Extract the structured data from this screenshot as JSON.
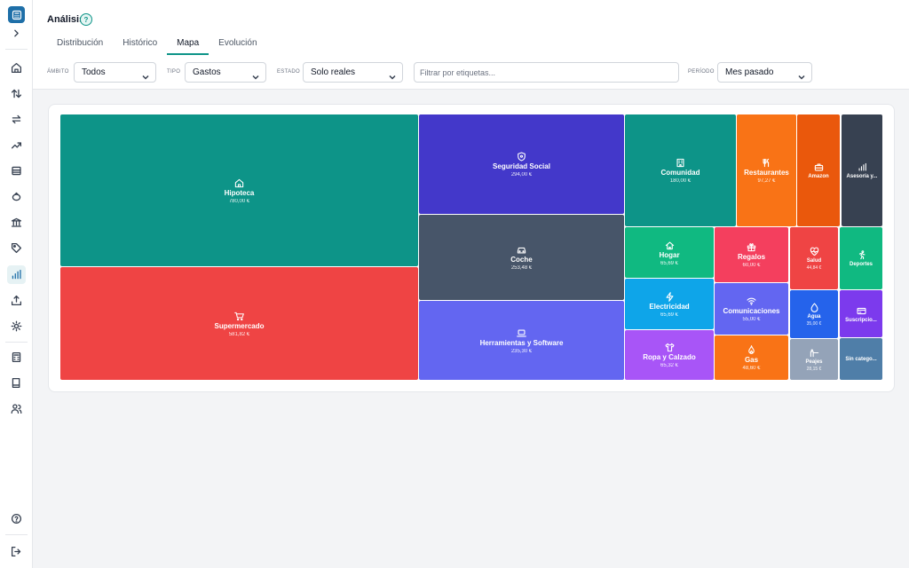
{
  "page": {
    "title": "Análisis",
    "help": "?"
  },
  "tabs": [
    {
      "label": "Distribución"
    },
    {
      "label": "Histórico"
    },
    {
      "label": "Mapa"
    },
    {
      "label": "Evolución"
    }
  ],
  "filters": {
    "ambito": {
      "label": "ÁMBITO",
      "value": "Todos"
    },
    "tipo": {
      "label": "TIPO",
      "value": "Gastos"
    },
    "estado": {
      "label": "ESTADO",
      "value": "Solo reales"
    },
    "etiquetas": {
      "placeholder": "Filtrar por etiquetas..."
    },
    "periodo": {
      "label": "PERÍODO",
      "value": "Mes pasado"
    }
  },
  "colors": {
    "accent": "#0d9488",
    "brand": "#1e6fa8"
  },
  "tiles": [
    {
      "name": "Hipoteca",
      "value": "780,00 €",
      "icon": "home-icon",
      "color": "#0d9488"
    },
    {
      "name": "Supermercado",
      "value": "581,82 €",
      "icon": "cart-icon",
      "color": "#ef4444"
    },
    {
      "name": "Seguridad Social",
      "value": "294,00 €",
      "icon": "shield-icon",
      "color": "#4338ca"
    },
    {
      "name": "Coche",
      "value": "253,48 €",
      "icon": "car-icon",
      "color": "#475569"
    },
    {
      "name": "Herramientas y Software",
      "value": "235,30 €",
      "icon": "laptop-icon",
      "color": "#6366f1"
    },
    {
      "name": "Comunidad",
      "value": "180,00 €",
      "icon": "building-icon",
      "color": "#0d9488"
    },
    {
      "name": "Restaurantes",
      "value": "97,27 €",
      "icon": "fork-knife-icon",
      "color": "#f97316"
    },
    {
      "name": "Amazon",
      "value": "",
      "icon": "briefcase-icon",
      "color": "#ea580c"
    },
    {
      "name": "Asesoría y...",
      "value": "",
      "icon": "bar-chart-icon",
      "color": "#374151"
    },
    {
      "name": "Hogar",
      "value": "65,69 €",
      "icon": "house-icon",
      "color": "#10b981"
    },
    {
      "name": "Regalos",
      "value": "60,00 €",
      "icon": "gift-icon",
      "color": "#f43f5e"
    },
    {
      "name": "Salud",
      "value": "44,84 €",
      "icon": "heart-pulse-icon",
      "color": "#ef4444"
    },
    {
      "name": "Deportes",
      "value": "",
      "icon": "running-icon",
      "color": "#10b981"
    },
    {
      "name": "Electricidad",
      "value": "65,69 €",
      "icon": "bolt-icon",
      "color": "#0ea5e9"
    },
    {
      "name": "Comunicaciones",
      "value": "55,00 €",
      "icon": "wifi-icon",
      "color": "#6366f1"
    },
    {
      "name": "Agua",
      "value": "35,00 €",
      "icon": "drop-icon",
      "color": "#2563eb"
    },
    {
      "name": "Suscripcio...",
      "value": "",
      "icon": "card-icon",
      "color": "#7c3aed"
    },
    {
      "name": "Ropa y Calzado",
      "value": "65,32 €",
      "icon": "shirt-icon",
      "color": "#a855f7"
    },
    {
      "name": "Gas",
      "value": "48,60 €",
      "icon": "flame-icon",
      "color": "#f97316"
    },
    {
      "name": "Peajes",
      "value": "28,15 €",
      "icon": "toll-icon",
      "color": "#94a3b8"
    },
    {
      "name": "Sin catego...",
      "value": "",
      "icon": "",
      "color": "#4f7ea8"
    }
  ]
}
